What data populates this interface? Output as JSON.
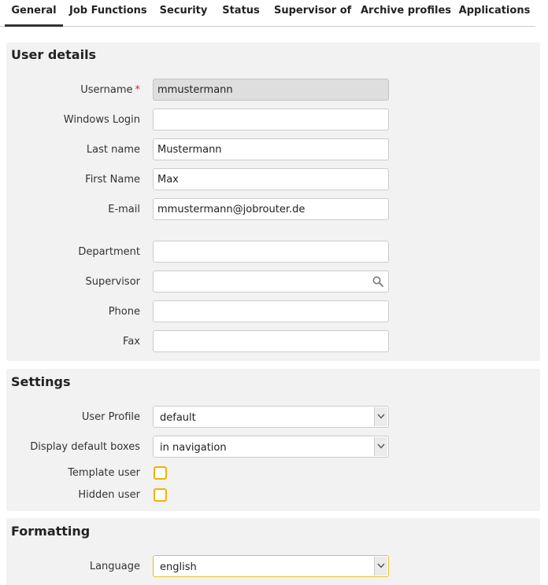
{
  "tabs": [
    "General",
    "Job Functions",
    "Security",
    "Status",
    "Supervisor of",
    "Archive profiles",
    "Applications"
  ],
  "user_details": {
    "title": "User details",
    "username": {
      "label": "Username",
      "required_mark": "*",
      "value": "mmustermann"
    },
    "windows_login": {
      "label": "Windows Login",
      "value": ""
    },
    "last_name": {
      "label": "Last name",
      "value": "Mustermann"
    },
    "first_name": {
      "label": "First Name",
      "value": "Max"
    },
    "email": {
      "label": "E-mail",
      "value": "mmustermann@jobrouter.de"
    },
    "department": {
      "label": "Department",
      "value": ""
    },
    "supervisor": {
      "label": "Supervisor",
      "value": "",
      "icon": "search-icon"
    },
    "phone": {
      "label": "Phone",
      "value": ""
    },
    "fax": {
      "label": "Fax",
      "value": ""
    }
  },
  "settings": {
    "title": "Settings",
    "user_profile": {
      "label": "User Profile",
      "value": "default"
    },
    "display_default_boxes": {
      "label": "Display default boxes",
      "value": "in navigation"
    },
    "template_user": {
      "label": "Template user",
      "checked": false
    },
    "hidden_user": {
      "label": "Hidden user",
      "checked": false
    }
  },
  "formatting": {
    "title": "Formatting",
    "language": {
      "label": "Language",
      "value": "english"
    }
  },
  "colors": {
    "accent": "#f0b400",
    "required": "#d9232d",
    "panel_bg": "#f2f2f2"
  }
}
